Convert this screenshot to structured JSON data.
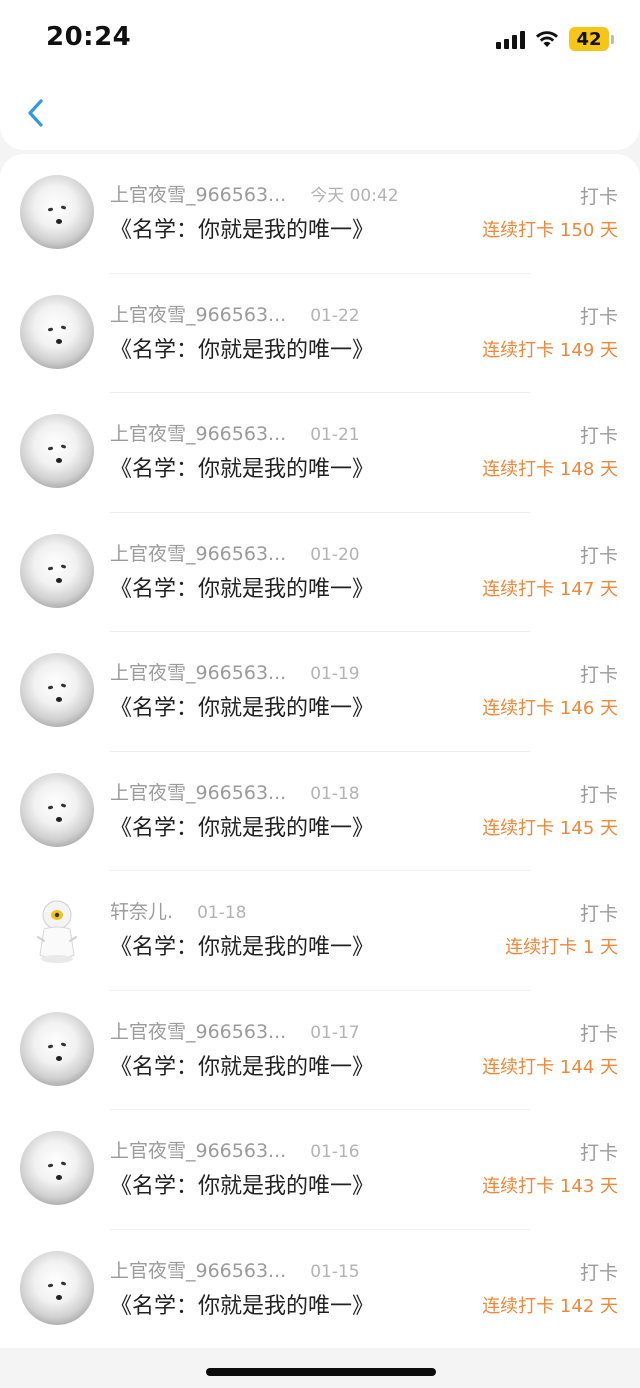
{
  "status": {
    "time": "20:24",
    "battery": "42",
    "icons": [
      "signal-icon",
      "wifi-icon",
      "battery-icon"
    ]
  },
  "nav": {
    "back_icon": "chevron-left-icon",
    "accent": "#2f9ae8"
  },
  "colors": {
    "streak": "#f0873a",
    "muted": "#9b9b9b",
    "text": "#222222"
  },
  "checkins": [
    {
      "user": "上官夜雪_966563...",
      "date": "今天 00:42",
      "title": "《名学：你就是我的唯一》",
      "action": "打卡",
      "streak": "连续打卡 150 天",
      "avatar": "cat-avatar"
    },
    {
      "user": "上官夜雪_966563...",
      "date": "01-22",
      "title": "《名学：你就是我的唯一》",
      "action": "打卡",
      "streak": "连续打卡 149 天",
      "avatar": "cat-avatar"
    },
    {
      "user": "上官夜雪_966563...",
      "date": "01-21",
      "title": "《名学：你就是我的唯一》",
      "action": "打卡",
      "streak": "连续打卡 148 天",
      "avatar": "cat-avatar"
    },
    {
      "user": "上官夜雪_966563...",
      "date": "01-20",
      "title": "《名学：你就是我的唯一》",
      "action": "打卡",
      "streak": "连续打卡 147 天",
      "avatar": "cat-avatar"
    },
    {
      "user": "上官夜雪_966563...",
      "date": "01-19",
      "title": "《名学：你就是我的唯一》",
      "action": "打卡",
      "streak": "连续打卡 146 天",
      "avatar": "cat-avatar"
    },
    {
      "user": "上官夜雪_966563...",
      "date": "01-18",
      "title": "《名学：你就是我的唯一》",
      "action": "打卡",
      "streak": "连续打卡 145 天",
      "avatar": "cat-avatar"
    },
    {
      "user": "轩奈儿.",
      "date": "01-18",
      "title": "《名学：你就是我的唯一》",
      "action": "打卡",
      "streak": "连续打卡 1 天",
      "avatar": "cartoon-avatar"
    },
    {
      "user": "上官夜雪_966563...",
      "date": "01-17",
      "title": "《名学：你就是我的唯一》",
      "action": "打卡",
      "streak": "连续打卡 144 天",
      "avatar": "cat-avatar"
    },
    {
      "user": "上官夜雪_966563...",
      "date": "01-16",
      "title": "《名学：你就是我的唯一》",
      "action": "打卡",
      "streak": "连续打卡 143 天",
      "avatar": "cat-avatar"
    },
    {
      "user": "上官夜雪_966563...",
      "date": "01-15",
      "title": "《名学：你就是我的唯一》",
      "action": "打卡",
      "streak": "连续打卡 142 天",
      "avatar": "cat-avatar"
    }
  ]
}
